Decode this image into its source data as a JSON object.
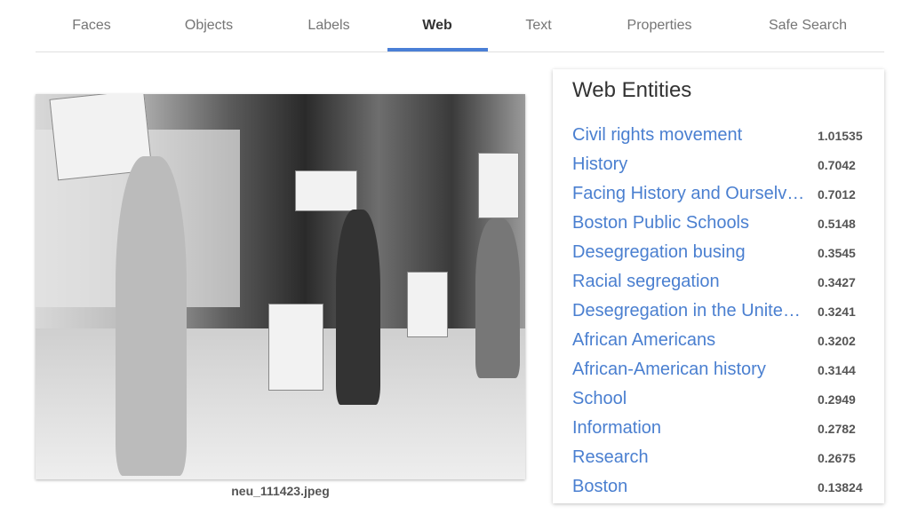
{
  "tabs": [
    {
      "label": "Faces"
    },
    {
      "label": "Objects"
    },
    {
      "label": "Labels"
    },
    {
      "label": "Web",
      "active": true
    },
    {
      "label": "Text"
    },
    {
      "label": "Properties"
    },
    {
      "label": "Safe Search"
    }
  ],
  "accent_color": "#4a7fd6",
  "image": {
    "caption": "neu_111423.jpeg"
  },
  "web_entities": {
    "title": "Web Entities",
    "items": [
      {
        "name": "Civil rights movement",
        "score": "1.01535"
      },
      {
        "name": "History",
        "score": "0.7042"
      },
      {
        "name": "Facing History and Ourselves",
        "score": "0.7012"
      },
      {
        "name": "Boston Public Schools",
        "score": "0.5148"
      },
      {
        "name": "Desegregation busing",
        "score": "0.3545"
      },
      {
        "name": "Racial segregation",
        "score": "0.3427"
      },
      {
        "name": "Desegregation in the United States",
        "score": "0.3241"
      },
      {
        "name": "African Americans",
        "score": "0.3202"
      },
      {
        "name": "African-American history",
        "score": "0.3144"
      },
      {
        "name": "School",
        "score": "0.2949"
      },
      {
        "name": "Information",
        "score": "0.2782"
      },
      {
        "name": "Research",
        "score": "0.2675"
      },
      {
        "name": "Boston",
        "score": "0.13824"
      }
    ]
  }
}
